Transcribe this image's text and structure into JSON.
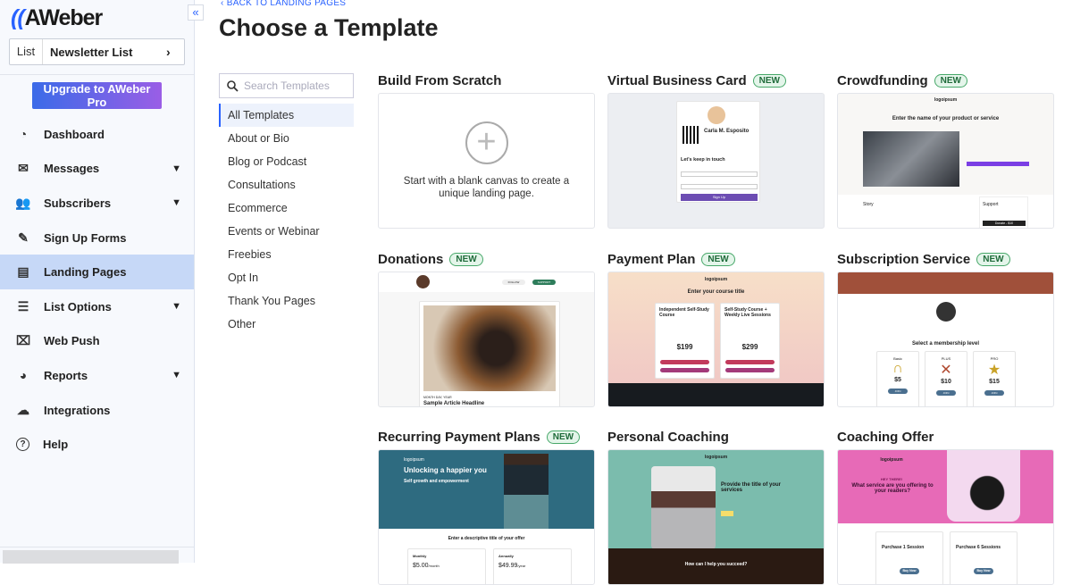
{
  "brand": {
    "logo": "AWeber",
    "accent": "#2962ff"
  },
  "sidebar": {
    "collapse_icon": "double-chevron-left",
    "list_label": "List",
    "list_value": "Newsletter List",
    "upgrade": "Upgrade to AWeber Pro",
    "items": [
      {
        "label": "Dashboard",
        "icon": "dashboard-gauge",
        "chevron": false
      },
      {
        "label": "Messages",
        "icon": "envelope",
        "chevron": true
      },
      {
        "label": "Subscribers",
        "icon": "users",
        "chevron": true
      },
      {
        "label": "Sign Up Forms",
        "icon": "pen",
        "chevron": false
      },
      {
        "label": "Landing Pages",
        "icon": "browser-window",
        "chevron": false,
        "active": true
      },
      {
        "label": "List Options",
        "icon": "sliders",
        "chevron": true
      },
      {
        "label": "Web Push",
        "icon": "push-message",
        "chevron": false
      },
      {
        "label": "Reports",
        "icon": "pie-chart",
        "chevron": true
      },
      {
        "label": "Integrations",
        "icon": "cloud-plug",
        "chevron": false
      },
      {
        "label": "Help",
        "icon": "question-circle",
        "chevron": false
      }
    ]
  },
  "main": {
    "back": "BACK TO LANDING PAGES",
    "title": "Choose a Template",
    "search_placeholder": "Search Templates",
    "categories": [
      "All Templates",
      "About or Bio",
      "Blog or Podcast",
      "Consultations",
      "Ecommerce",
      "Events or Webinar",
      "Freebies",
      "Opt In",
      "Thank You Pages",
      "Other"
    ],
    "new_badge": "NEW",
    "templates": [
      {
        "name": "Build From Scratch",
        "new": false,
        "desc": "Start with a blank canvas to create a unique landing page."
      },
      {
        "name": "Virtual Business Card",
        "new": true,
        "person": "Carla M. Esposito",
        "form_title": "Let's keep in touch",
        "cta": "Sign Up"
      },
      {
        "name": "Crowdfunding",
        "new": true,
        "logo": "logoipsum",
        "headline": "Enter the name of your product or service",
        "side1": "Story",
        "side2": "Support",
        "cta": "Donate - $10"
      },
      {
        "name": "Donations",
        "new": true,
        "follow": "FOLLOW",
        "support": "SUPPORT",
        "date": "MONTH DAY, YEAR",
        "headline": "Sample Article Headline"
      },
      {
        "name": "Payment Plan",
        "new": true,
        "logo": "logoipsum",
        "headline": "Enter your course title",
        "plan1": "Independent Self-Study Course",
        "plan2": "Self-Study Course + Weekly Live Sessions",
        "price1": "$199",
        "price2": "$299"
      },
      {
        "name": "Subscription Service",
        "new": true,
        "headline": "Select a membership level",
        "tiers": [
          "Basic",
          "PLUS",
          "PRO"
        ],
        "prices": [
          "$5",
          "$10",
          "$15"
        ],
        "join": "JOIN"
      },
      {
        "name": "Recurring Payment Plans",
        "new": true,
        "logo": "logoipsum",
        "headline": "Unlocking a happier you",
        "sub": "Self growth and empowerment",
        "offer": "Enter a descriptive title of your offer",
        "plan1": "Monthly",
        "plan2": "Annually",
        "price1": "$5.00",
        "price2": "$49.99",
        "unit1": "/month",
        "unit2": "/year"
      },
      {
        "name": "Personal Coaching",
        "new": false,
        "logo": "logoipsum",
        "headline": "Provide the title of your services",
        "footer": "How can I help you succeed?"
      },
      {
        "name": "Coaching Offer",
        "new": false,
        "logo": "logoipsum",
        "kicker": "HEY THERE!",
        "headline": "What service are you offering to your readers?",
        "opt1": "Purchase 1 Session",
        "opt2": "Purchase 6 Sessions",
        "buy": "Buy Now"
      }
    ]
  }
}
